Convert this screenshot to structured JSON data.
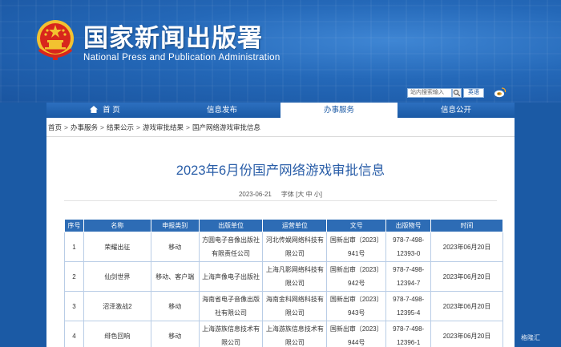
{
  "header": {
    "org_name_cn": "国家新闻出版署",
    "org_name_en": "National Press and Publication Administration",
    "search": {
      "placeholder": "站内搜索输入"
    },
    "lang_label": "英语"
  },
  "nav": [
    {
      "label": "首  页",
      "icon": "home-icon"
    },
    {
      "label": "信息发布"
    },
    {
      "label": "办事服务",
      "active": true
    },
    {
      "label": "信息公开"
    }
  ],
  "breadcrumb": [
    "首页",
    "办事服务",
    "结果公示",
    "游戏审批结果",
    "国产网络游戏审批信息"
  ],
  "article": {
    "title": "2023年6月份国产网络游戏审批信息",
    "date": "2023-06-21",
    "font_size_label": "字体 [",
    "font_sizes": [
      "大",
      "中",
      "小"
    ],
    "font_size_close": "]"
  },
  "table": {
    "headers": [
      "序号",
      "名称",
      "申报类别",
      "出版单位",
      "运营单位",
      "文号",
      "出版物号",
      "时间"
    ],
    "rows": [
      [
        "1",
        "荣耀出征",
        "移动",
        "方圆电子音像出版社有限责任公司",
        "河北传娱网络科技有限公司",
        "国新出审〔2023〕941号",
        "978-7-498-12393-0",
        "2023年06月20日"
      ],
      [
        "2",
        "仙剑世界",
        "移动、客户端",
        "上海声像电子出版社",
        "上海凡影网络科技有限公司",
        "国新出审〔2023〕942号",
        "978-7-498-12394-7",
        "2023年06月20日"
      ],
      [
        "3",
        "沼泽激战2",
        "移动",
        "海南省电子音像出版社有限公司",
        "海南金科网络科技有限公司",
        "国新出审〔2023〕943号",
        "978-7-498-12395-4",
        "2023年06月20日"
      ],
      [
        "4",
        "绯色回响",
        "移动",
        "上海游族信息技术有限公司",
        "上海游族信息技术有限公司",
        "国新出审〔2023〕944号",
        "978-7-498-12396-1",
        "2023年06月20日"
      ]
    ]
  },
  "watermark": "格隆汇",
  "colors": {
    "brand_blue": "#1b5aa5",
    "title_blue": "#2a5ea8",
    "header_row": "#2d6cb5"
  }
}
